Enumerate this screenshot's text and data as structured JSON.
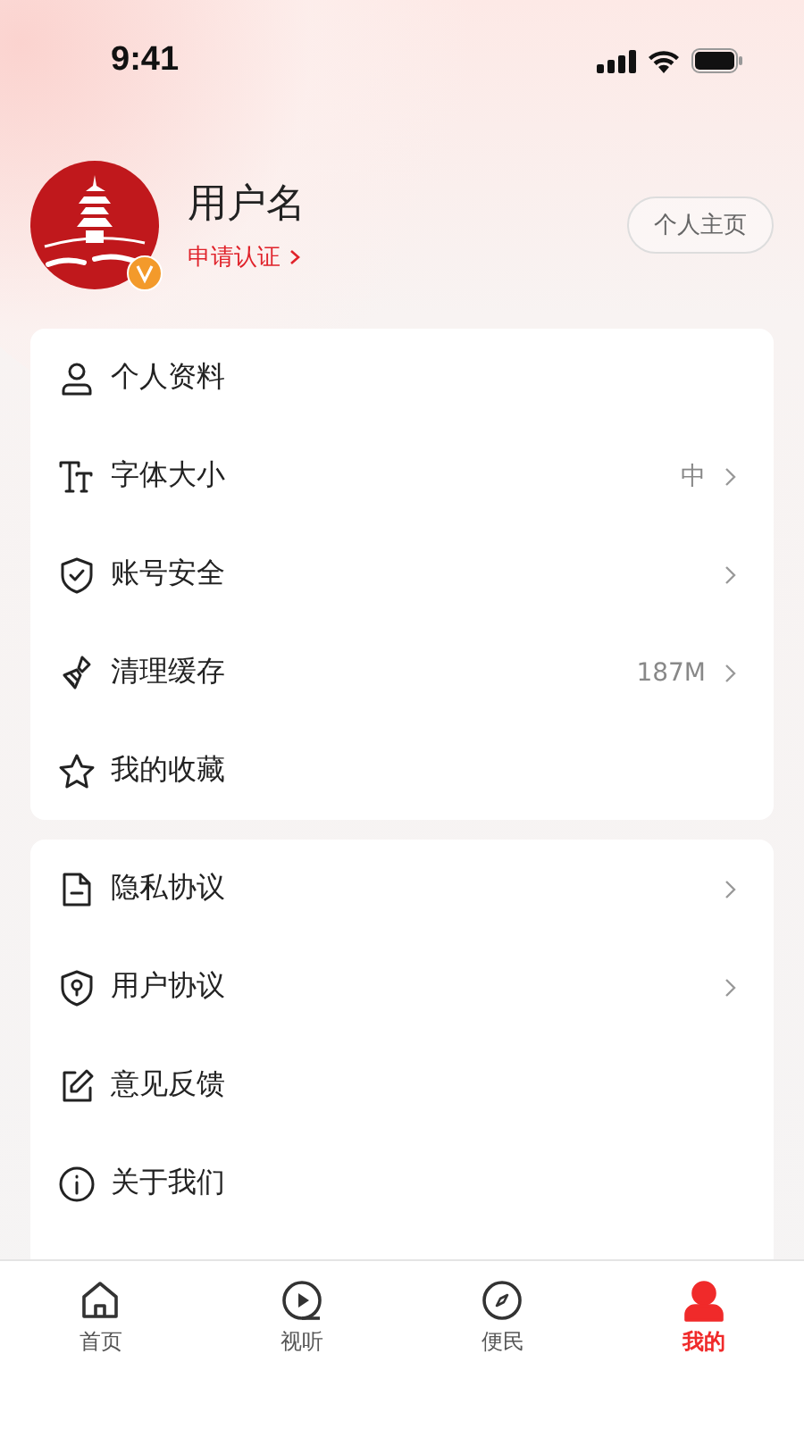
{
  "status_bar": {
    "time": "9:41"
  },
  "profile": {
    "name": "用户名",
    "verify_link": "申请认证",
    "verified": true,
    "homepage_button": "个人主页"
  },
  "menu_groups": [
    {
      "items": [
        {
          "label": "个人资料",
          "chevron": false
        },
        {
          "label": "字体大小",
          "value": "中",
          "chevron": true
        },
        {
          "label": "账号安全",
          "chevron": true
        },
        {
          "label": "清理缓存",
          "value": "187M",
          "chevron": true
        },
        {
          "label": "我的收藏",
          "chevron": false
        }
      ]
    },
    {
      "items": [
        {
          "label": "隐私协议",
          "chevron": true
        },
        {
          "label": "用户协议",
          "chevron": true
        },
        {
          "label": "意见反馈",
          "chevron": false
        },
        {
          "label": "关于我们",
          "chevron": false
        }
      ]
    }
  ],
  "tab_bar": [
    {
      "label": "首页",
      "selected": false
    },
    {
      "label": "视听",
      "selected": false
    },
    {
      "label": "便民",
      "selected": false
    },
    {
      "label": "我的",
      "selected": true
    }
  ]
}
